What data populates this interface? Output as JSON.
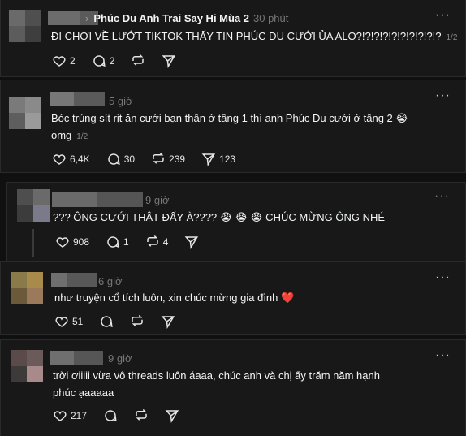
{
  "posts": [
    {
      "author_label": "Phúc Du Anh Trai Say Hi Mùa 2",
      "time": "30 phút",
      "text": "ĐI CHƠI VỀ LƯỚT TIKTOK THẤY TIN PHÚC DU CƯỚI ỦA ALO?!?!?!?!?!?!?!?!?!?",
      "page": "1/2",
      "likes": "2",
      "replies": "2",
      "reposts": "",
      "shares": ""
    },
    {
      "time": "5 giờ",
      "text": "Bóc trúng sít rịt ăn cưới bạn thân ở tầng 1 thì anh Phúc Du cưới ở tầng 2 😭",
      "text2": "omg",
      "page": "1/2",
      "likes": "6,4K",
      "replies": "30",
      "reposts": "239",
      "shares": "123"
    },
    {
      "time": "9 giờ",
      "text": "??? ÔNG CƯỚI THẬT ĐẤY À???? 😭 😭 😭 CHÚC MỪNG ÔNG NHÉ",
      "likes": "908",
      "replies": "1",
      "reposts": "4",
      "shares": ""
    },
    {
      "time": "6 giờ",
      "text": "như truyện cổ tích luôn, xin chúc mừng gia đình ❤️",
      "likes": "51",
      "replies": "",
      "reposts": "",
      "shares": ""
    },
    {
      "time": "9 giờ",
      "text": "trời ơiiiii vừa vô threads luôn áaaa, chúc anh và chị ấy trăm năm hạnh",
      "text2": "phúc ạaaaaa",
      "likes": "217",
      "replies": "",
      "reposts": "",
      "shares": ""
    }
  ],
  "icons": {
    "more": "more-icon",
    "like": "heart-icon",
    "reply": "comment-icon",
    "repost": "repost-icon",
    "share": "send-icon"
  }
}
